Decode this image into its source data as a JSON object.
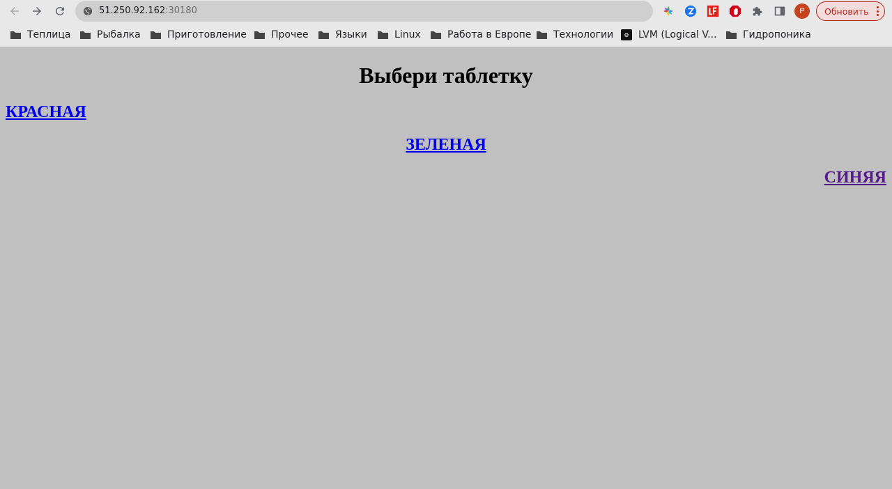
{
  "browser": {
    "url_host": "51.250.92.162",
    "url_port": ":30180",
    "update_label": "Обновить",
    "avatar_letter": "P"
  },
  "bookmarks": [
    {
      "label": "Теплица",
      "icon": "folder-icon"
    },
    {
      "label": "Рыбалка",
      "icon": "folder-icon"
    },
    {
      "label": "Приготовление",
      "icon": "folder-icon"
    },
    {
      "label": "Прочее",
      "icon": "folder-icon"
    },
    {
      "label": "Языки",
      "icon": "folder-icon"
    },
    {
      "label": "Linux",
      "icon": "folder-icon"
    },
    {
      "label": "Работа в Европе",
      "icon": "folder-icon"
    },
    {
      "label": "Технологии",
      "icon": "folder-icon"
    },
    {
      "label": "LVM (Logical V...",
      "icon": "site-favicon"
    },
    {
      "label": "Гидропоника",
      "icon": "folder-icon"
    }
  ],
  "page": {
    "title": "Выбери таблетку",
    "links": {
      "red": "КРАСНАЯ",
      "green": "ЗЕЛЕНАЯ",
      "blue": "СИНЯЯ"
    },
    "colors": {
      "background": "#c0c0c0",
      "link": "#0000ee",
      "visited_link": "#551a8b"
    }
  }
}
